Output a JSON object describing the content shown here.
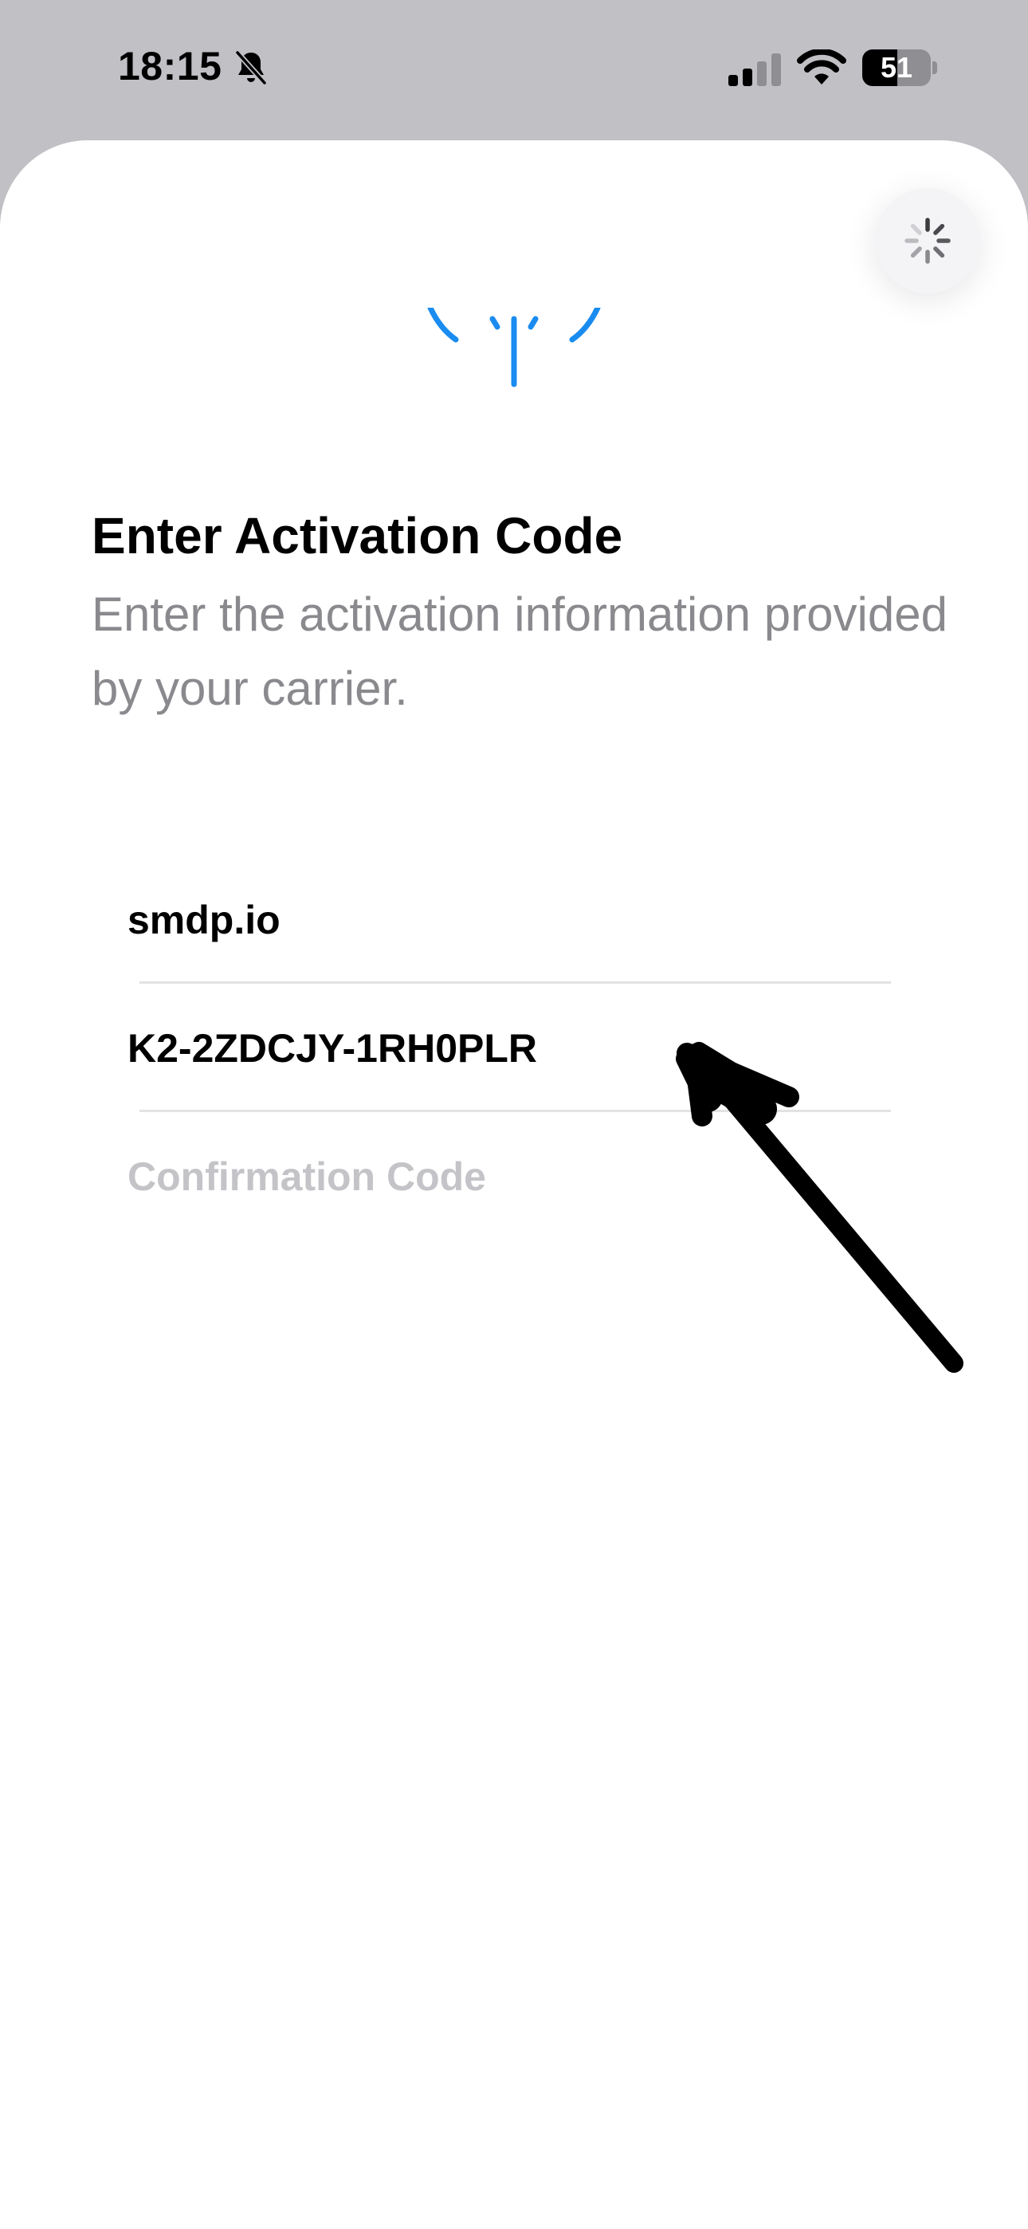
{
  "status_bar": {
    "time": "18:15",
    "battery_percent": "51",
    "battery_level": 0.51,
    "icons": [
      "bell-slash-icon",
      "cellular-signal-icon",
      "wifi-icon",
      "battery-icon"
    ]
  },
  "sheet": {
    "loading_icon": "spinner-icon",
    "header_icon": "antenna-icon",
    "title": "Enter Activation Code",
    "subtitle": "Enter the activation information provided by your carrier."
  },
  "form": {
    "smdp_address": {
      "value": "smdp.io",
      "placeholder": ""
    },
    "activation_code": {
      "value": "K2-2ZDCJY-1RH0PLR",
      "placeholder": ""
    },
    "confirmation_code": {
      "value": "",
      "placeholder": "Confirmation Code"
    }
  },
  "annotation": {
    "type": "arrow-icon",
    "color": "#000000"
  },
  "colors": {
    "accent": "#1a8cf0",
    "status_bar_background": "#c0c0c5",
    "sheet_background": "#ffffff",
    "secondary_text": "#8a8a8e",
    "placeholder_text": "#c4c4c8"
  }
}
